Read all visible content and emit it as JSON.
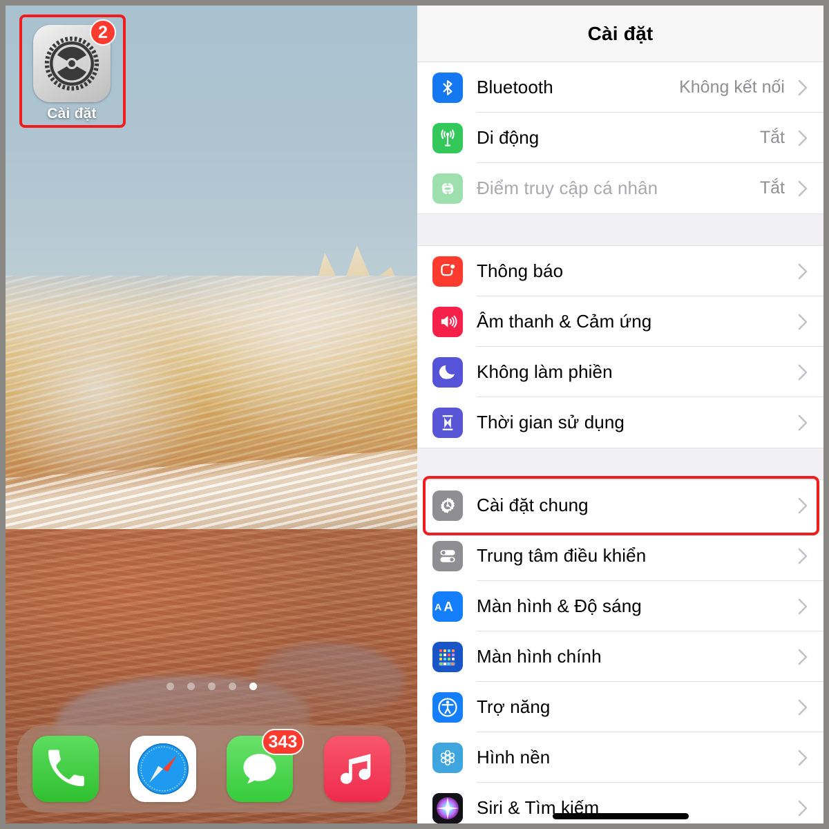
{
  "home_screen": {
    "app": {
      "name": "settings-app-icon",
      "label": "Cài đặt",
      "badge": "2",
      "highlighted": true
    },
    "page_dots": {
      "total": 5,
      "active_index": 4
    },
    "dock": [
      {
        "name": "phone",
        "badge": ""
      },
      {
        "name": "safari",
        "badge": ""
      },
      {
        "name": "messages",
        "badge": "343"
      },
      {
        "name": "music",
        "badge": ""
      }
    ],
    "wallpaper_colors": {
      "sky": "#aec4d0",
      "rock_light": "#d9b97e",
      "rock_red": "#a9603d"
    }
  },
  "settings": {
    "nav_title": "Cài đặt",
    "highlight_color": "#ef1d1d",
    "sections": [
      {
        "id": "connectivity",
        "rows": [
          {
            "icon": "bluetooth-icon",
            "icon_color": "#1578f0",
            "label": "Bluetooth",
            "value": "Không kết nối",
            "dimmed": false
          },
          {
            "icon": "cellular-icon",
            "icon_color": "#34c759",
            "label": "Di động",
            "value": "Tắt",
            "dimmed": false
          },
          {
            "icon": "personal-hotspot-icon",
            "icon_color": "#9ddfad",
            "label": "Điểm truy cập cá nhân",
            "value": "Tắt",
            "dimmed": true
          }
        ]
      },
      {
        "id": "alerts",
        "rows": [
          {
            "icon": "notifications-icon",
            "icon_color": "#ff3b30",
            "label": "Thông báo",
            "value": "",
            "dimmed": false
          },
          {
            "icon": "sounds-haptics-icon",
            "icon_color": "#f6214b",
            "label": "Âm thanh & Cảm ứng",
            "value": "",
            "dimmed": false
          },
          {
            "icon": "do-not-disturb-icon",
            "icon_color": "#5553d8",
            "label": "Không làm phiền",
            "value": "",
            "dimmed": false
          },
          {
            "icon": "screen-time-icon",
            "icon_color": "#5856d6",
            "label": "Thời gian sử dụng",
            "value": "",
            "dimmed": false
          }
        ]
      },
      {
        "id": "system",
        "rows": [
          {
            "icon": "general-gear-icon",
            "icon_color": "#8e8e93",
            "label": "Cài đặt chung",
            "value": "",
            "dimmed": false,
            "highlighted": true
          },
          {
            "icon": "control-center-icon",
            "icon_color": "#8e8e93",
            "label": "Trung tâm điều khiển",
            "value": "",
            "dimmed": false
          },
          {
            "icon": "display-brightness-icon",
            "icon_color": "#147efb",
            "label": "Màn hình & Độ sáng",
            "value": "",
            "dimmed": false
          },
          {
            "icon": "home-screen-icon",
            "icon_color": "#1a55c8",
            "label": "Màn hình chính",
            "value": "",
            "dimmed": false
          },
          {
            "icon": "accessibility-icon",
            "icon_color": "#147efb",
            "label": "Trợ năng",
            "value": "",
            "dimmed": false
          },
          {
            "icon": "wallpaper-icon",
            "icon_color": "#3ea6dd",
            "label": "Hình nền",
            "value": "",
            "dimmed": false
          },
          {
            "icon": "siri-search-icon",
            "icon_color": "#1c1c1e",
            "label": "Siri & Tìm kiếm",
            "value": "",
            "dimmed": false
          }
        ]
      }
    ]
  }
}
